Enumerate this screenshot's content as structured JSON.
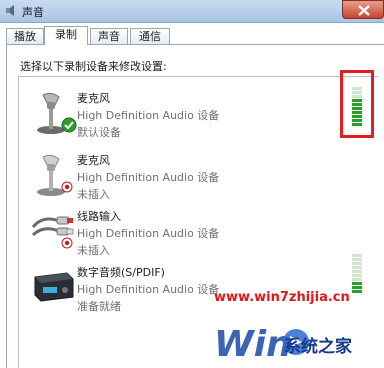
{
  "window": {
    "title": "声音"
  },
  "tabs": [
    {
      "label": "播放",
      "active": false
    },
    {
      "label": "录制",
      "active": true
    },
    {
      "label": "声音",
      "active": false
    },
    {
      "label": "通信",
      "active": false
    }
  ],
  "instructions": "选择以下录制设备来修改设置:",
  "devices": [
    {
      "name": "麦克风",
      "description": "High Definition Audio 设备",
      "status": "默认设备",
      "icon": "microphone-icon",
      "badge": "default-check-icon",
      "meter_level": 0.7
    },
    {
      "name": "麦克风",
      "description": "High Definition Audio 设备",
      "status": "未插入",
      "icon": "microphone-icon",
      "badge": "unplugged-icon"
    },
    {
      "name": "线路输入",
      "description": "High Definition Audio 设备",
      "status": "未插入",
      "icon": "line-in-cable-icon",
      "badge": "unplugged-icon"
    },
    {
      "name": "数字音频(S/PDIF)",
      "description": "High Definition Audio 设备",
      "status": "准备就绪",
      "icon": "spdif-device-icon",
      "meter_level": 0.3
    }
  ],
  "watermark": {
    "url": "www.win7zhijia.cn",
    "site_name": "系统之家"
  },
  "colors": {
    "highlight": "#e02020",
    "meter_on": "#2aa02a",
    "meter_off": "#cfe6cf"
  }
}
